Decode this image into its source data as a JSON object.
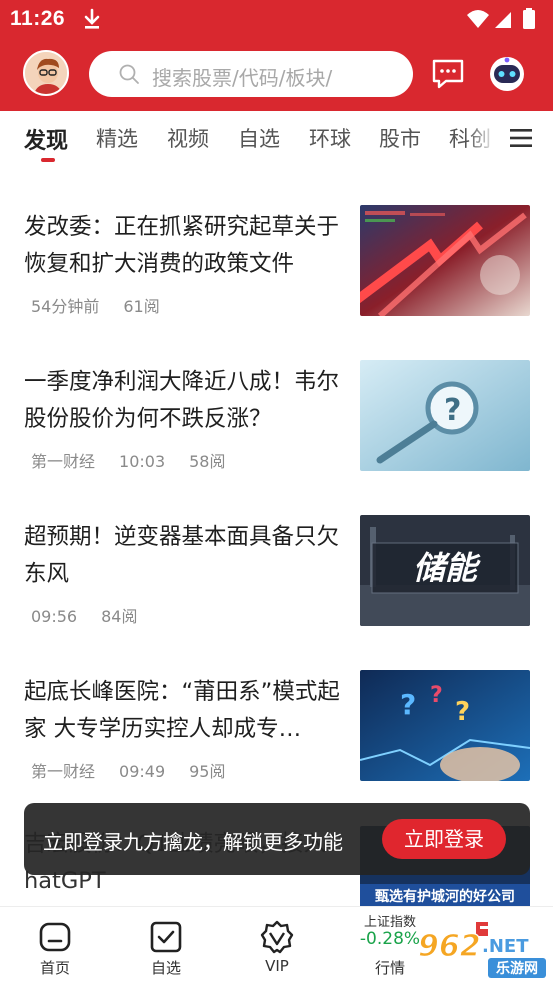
{
  "status": {
    "time": "11:26"
  },
  "search": {
    "placeholder": "搜索股票/代码/板块/"
  },
  "tabs": [
    {
      "label": "发现",
      "active": true
    },
    {
      "label": "精选"
    },
    {
      "label": "视频"
    },
    {
      "label": "自选"
    },
    {
      "label": "环球"
    },
    {
      "label": "股市"
    },
    {
      "label": "科创"
    }
  ],
  "articles": [
    {
      "title": "发改委：正在抓紧研究起草关于恢复和扩大消费的政策文件",
      "source": "",
      "time": "54分钟前",
      "reads": "61阅"
    },
    {
      "title": "一季度净利润大降近八成！韦尔股份股价为何不跌反涨？",
      "source": "第一财经",
      "time": "10:03",
      "reads": "58阅"
    },
    {
      "title": "超预期！逆变器基本面具备只欠东风",
      "source": "",
      "time": "09:56",
      "reads": "84阅",
      "thumb_text": "储能"
    },
    {
      "title": "起底长峰医院：“莆田系”模式起家 大专学历实控人却成专…",
      "source": "第一财经",
      "time": "09:49",
      "reads": "95阅"
    },
    {
      "title": "吉宏股份：Q1业绩亮眼，接入ChatGPT",
      "thumb_caption": "甄选有护城河的好公司"
    }
  ],
  "toast": {
    "text": "立即登录九方擒龙，解锁更多功能",
    "button": "立即登录"
  },
  "bottom_nav": [
    {
      "label": "首页"
    },
    {
      "label": "自选"
    },
    {
      "label": "VIP"
    }
  ],
  "market": {
    "name": "上证指数",
    "change": "-0.28%",
    "label": "行情"
  },
  "watermark": {
    "text": "962",
    "suffix": ".NET",
    "sub": "乐游网"
  },
  "colors": {
    "brand_red": "#d9282f",
    "down_green": "#1aa34a"
  }
}
